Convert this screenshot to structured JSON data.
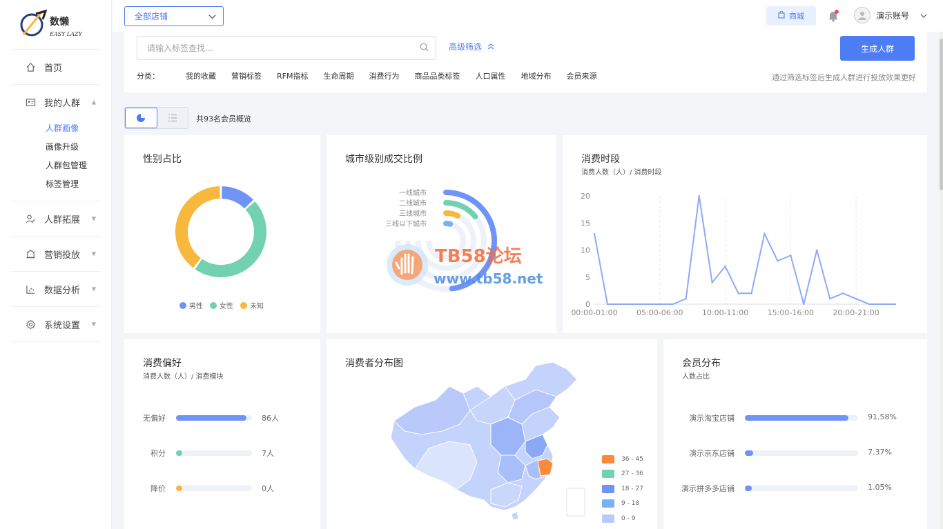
{
  "brand": {
    "name": "数懒",
    "tagline": "EASY LAZY"
  },
  "sidebar": {
    "items": [
      {
        "label": "首页",
        "icon": "home-icon"
      },
      {
        "label": "我的人群",
        "icon": "id-card-icon",
        "expanded": true,
        "children": [
          {
            "label": "人群画像",
            "active": true
          },
          {
            "label": "画像升级"
          },
          {
            "label": "人群包管理"
          },
          {
            "label": "标签管理"
          }
        ]
      },
      {
        "label": "人群拓展",
        "icon": "users-icon"
      },
      {
        "label": "营销投放",
        "icon": "alarm-icon"
      },
      {
        "label": "数据分析",
        "icon": "chart-icon"
      },
      {
        "label": "系统设置",
        "icon": "gear-icon"
      }
    ]
  },
  "topbar": {
    "store_select": "全部店铺",
    "mall_button": "商城",
    "account_name": "演示账号"
  },
  "filter": {
    "search_placeholder": "请输入标签查找...",
    "advanced": "高级筛选",
    "generate_button": "生成人群",
    "category_label": "分类：",
    "categories": [
      "我的收藏",
      "营销标签",
      "RFM指标",
      "生命周期",
      "消费行为",
      "商品品类标签",
      "人口属性",
      "地域分布",
      "会员来源"
    ],
    "hint": "通过筛选标签后生成人群进行投放效果更好"
  },
  "overview": {
    "text": "共93名会员概览"
  },
  "cards": {
    "gender": {
      "title": "性别占比",
      "legend": [
        {
          "label": "男性",
          "color": "#6f93f7"
        },
        {
          "label": "女性",
          "color": "#72d1b1"
        },
        {
          "label": "未知",
          "color": "#f8b83e"
        }
      ]
    },
    "city": {
      "title": "城市级别成交比例",
      "labels": [
        "一线城市",
        "二线城市",
        "三线城市",
        "三线以下城市"
      ]
    },
    "time": {
      "title": "消费时段",
      "subtitle": "消费人数（人）/ 消费时段"
    },
    "pref": {
      "title": "消费偏好",
      "subtitle": "消费人数（人）/ 消费模块"
    },
    "map": {
      "title": "消费者分布图",
      "legend": [
        {
          "label": "36 - 45",
          "color": "#f88a3a"
        },
        {
          "label": "27 - 36",
          "color": "#72d1b1"
        },
        {
          "label": "18 - 27",
          "color": "#6f93f7"
        },
        {
          "label": "9 - 18",
          "color": "#77b2f4"
        },
        {
          "label": "0 - 9",
          "color": "#b9c9fa"
        }
      ]
    },
    "member": {
      "title": "会员分布",
      "subtitle": "人数占比"
    }
  },
  "watermark": {
    "text1": "TB58论坛",
    "text2": "www.tb58.net"
  },
  "chart_data": [
    {
      "type": "pie",
      "title": "性别占比",
      "categories": [
        "男性",
        "女性",
        "未知"
      ],
      "values": [
        13,
        47,
        40
      ],
      "colors": [
        "#6f93f7",
        "#72d1b1",
        "#f8b83e"
      ]
    },
    {
      "type": "bar",
      "title": "城市级别成交比例",
      "categories": [
        "一线城市",
        "二线城市",
        "三线城市",
        "三线以下城市"
      ],
      "values": [
        48,
        14,
        7,
        4
      ],
      "colors": [
        "#6f93f7",
        "#72d1b1",
        "#f8b83e",
        "#77b2f4"
      ]
    },
    {
      "type": "line",
      "title": "消费时段",
      "subtitle": "消费人数（人）/ 消费时段",
      "x": [
        "00:00-01:00",
        "01:00-02:00",
        "02:00-03:00",
        "03:00-04:00",
        "04:00-05:00",
        "05:00-06:00",
        "06:00-07:00",
        "07:00-08:00",
        "08:00-09:00",
        "09:00-10:00",
        "10:00-11:00",
        "11:00-12:00",
        "12:00-13:00",
        "13:00-14:00",
        "14:00-15:00",
        "15:00-16:00",
        "16:00-17:00",
        "17:00-18:00",
        "18:00-19:00",
        "19:00-20:00",
        "20:00-21:00",
        "21:00-22:00",
        "22:00-23:00",
        "23:00-24:00"
      ],
      "xticks": [
        "00:00-01:00",
        "05:00-06:00",
        "10:00-11:00",
        "15:00-16:00",
        "20:00-21:00"
      ],
      "values": [
        13,
        0,
        0,
        0,
        0,
        0,
        0,
        1,
        20,
        4,
        7,
        2,
        2,
        13,
        8,
        9,
        0,
        10,
        1,
        2,
        1,
        0,
        0,
        0
      ],
      "yticks": [
        0,
        5,
        10,
        15,
        20
      ],
      "ylim": [
        0,
        20
      ],
      "color": "#8ea9f8"
    },
    {
      "type": "bar",
      "title": "消费偏好",
      "subtitle": "消费人数（人）/ 消费模块",
      "categories": [
        "无偏好",
        "积分",
        "降价"
      ],
      "values": [
        86,
        7,
        0
      ],
      "value_labels": [
        "86人",
        "7人",
        "0人"
      ],
      "max": 93,
      "colors": [
        "#6f93f7",
        "#72d1b1",
        "#f8b83e"
      ]
    },
    {
      "type": "bar",
      "title": "会员分布",
      "subtitle": "人数占比",
      "categories": [
        "演示淘宝店铺",
        "演示京东店铺",
        "演示拼多多店铺"
      ],
      "values": [
        91.58,
        7.37,
        1.05
      ],
      "value_labels": [
        "91.58%",
        "7.37%",
        "1.05%"
      ],
      "max": 100,
      "colors": [
        "#6f93f7",
        "#6f93f7",
        "#6f93f7"
      ]
    }
  ]
}
